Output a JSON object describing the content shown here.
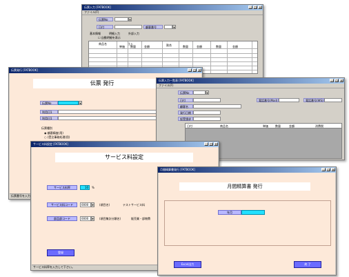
{
  "windows": {
    "w1": {
      "title": "伝票入力 [FATBOOK]",
      "menu": "ファイル(F)",
      "slip_no_label": "伝票No",
      "date_label": "日付",
      "customer_label": "顧客番号",
      "tabs": [
        "基本情報",
        "明細入力",
        "外部入力"
      ],
      "checkbox_label": "自動明細を表示",
      "grid_headers": [
        "商品名",
        "仕入",
        "単価",
        "数量",
        "金額",
        "割合",
        "数量",
        "金額",
        "数量",
        "金額"
      ]
    },
    "w2": {
      "title": "伝票発行 [FATBOOK]",
      "heading": "伝票 発行",
      "slip_no_label": "伝票No",
      "use_start_label": "利用日1",
      "use_end_label": "利用日2",
      "group_label": "伝票種別",
      "radio_1": "顧客精査(用)",
      "radio_2": "(受注事務処理(用)",
      "status": "伝票番号を入力して下さい。"
    },
    "w3": {
      "title": "伝票入力一覧表 [FATBOOK]",
      "slip_no_label": "伝票No",
      "date_label": "日付",
      "customer_label": "顧客名",
      "deliver_date_label": "発行日期",
      "sales_label": "仮受請求",
      "tel1_label": "電話番号(Mail)",
      "tel2_label": "電話番号(WS)",
      "grid_headers": [
        "日付",
        "商品名",
        "単価",
        "数量",
        "金額",
        "消費税"
      ]
    },
    "w4": {
      "title": "サービス料設定 [FATBOOK]",
      "heading": "サービス料設定",
      "rate_label": "サービス料率",
      "rate_value": "10",
      "rate_unit": "%",
      "code_label": "サービス料コード",
      "code_value": "0000",
      "code_name_label": "(項目名)",
      "code_name_value": "テストサービス料",
      "dept_label": "部品部コード",
      "dept_value": "0000",
      "dept_name_label": "(項目集計分類名)",
      "dept_name_value": "販売業・部物費",
      "register_button": "登録",
      "status": "サービス料率を入力して下さい。"
    },
    "w5": {
      "title": "月間精算書発行 [FATBOOK]",
      "heading": "月間精算書 発行",
      "month_label": "年月",
      "excel_button": "Excel出力",
      "close_button": "終 了"
    }
  }
}
